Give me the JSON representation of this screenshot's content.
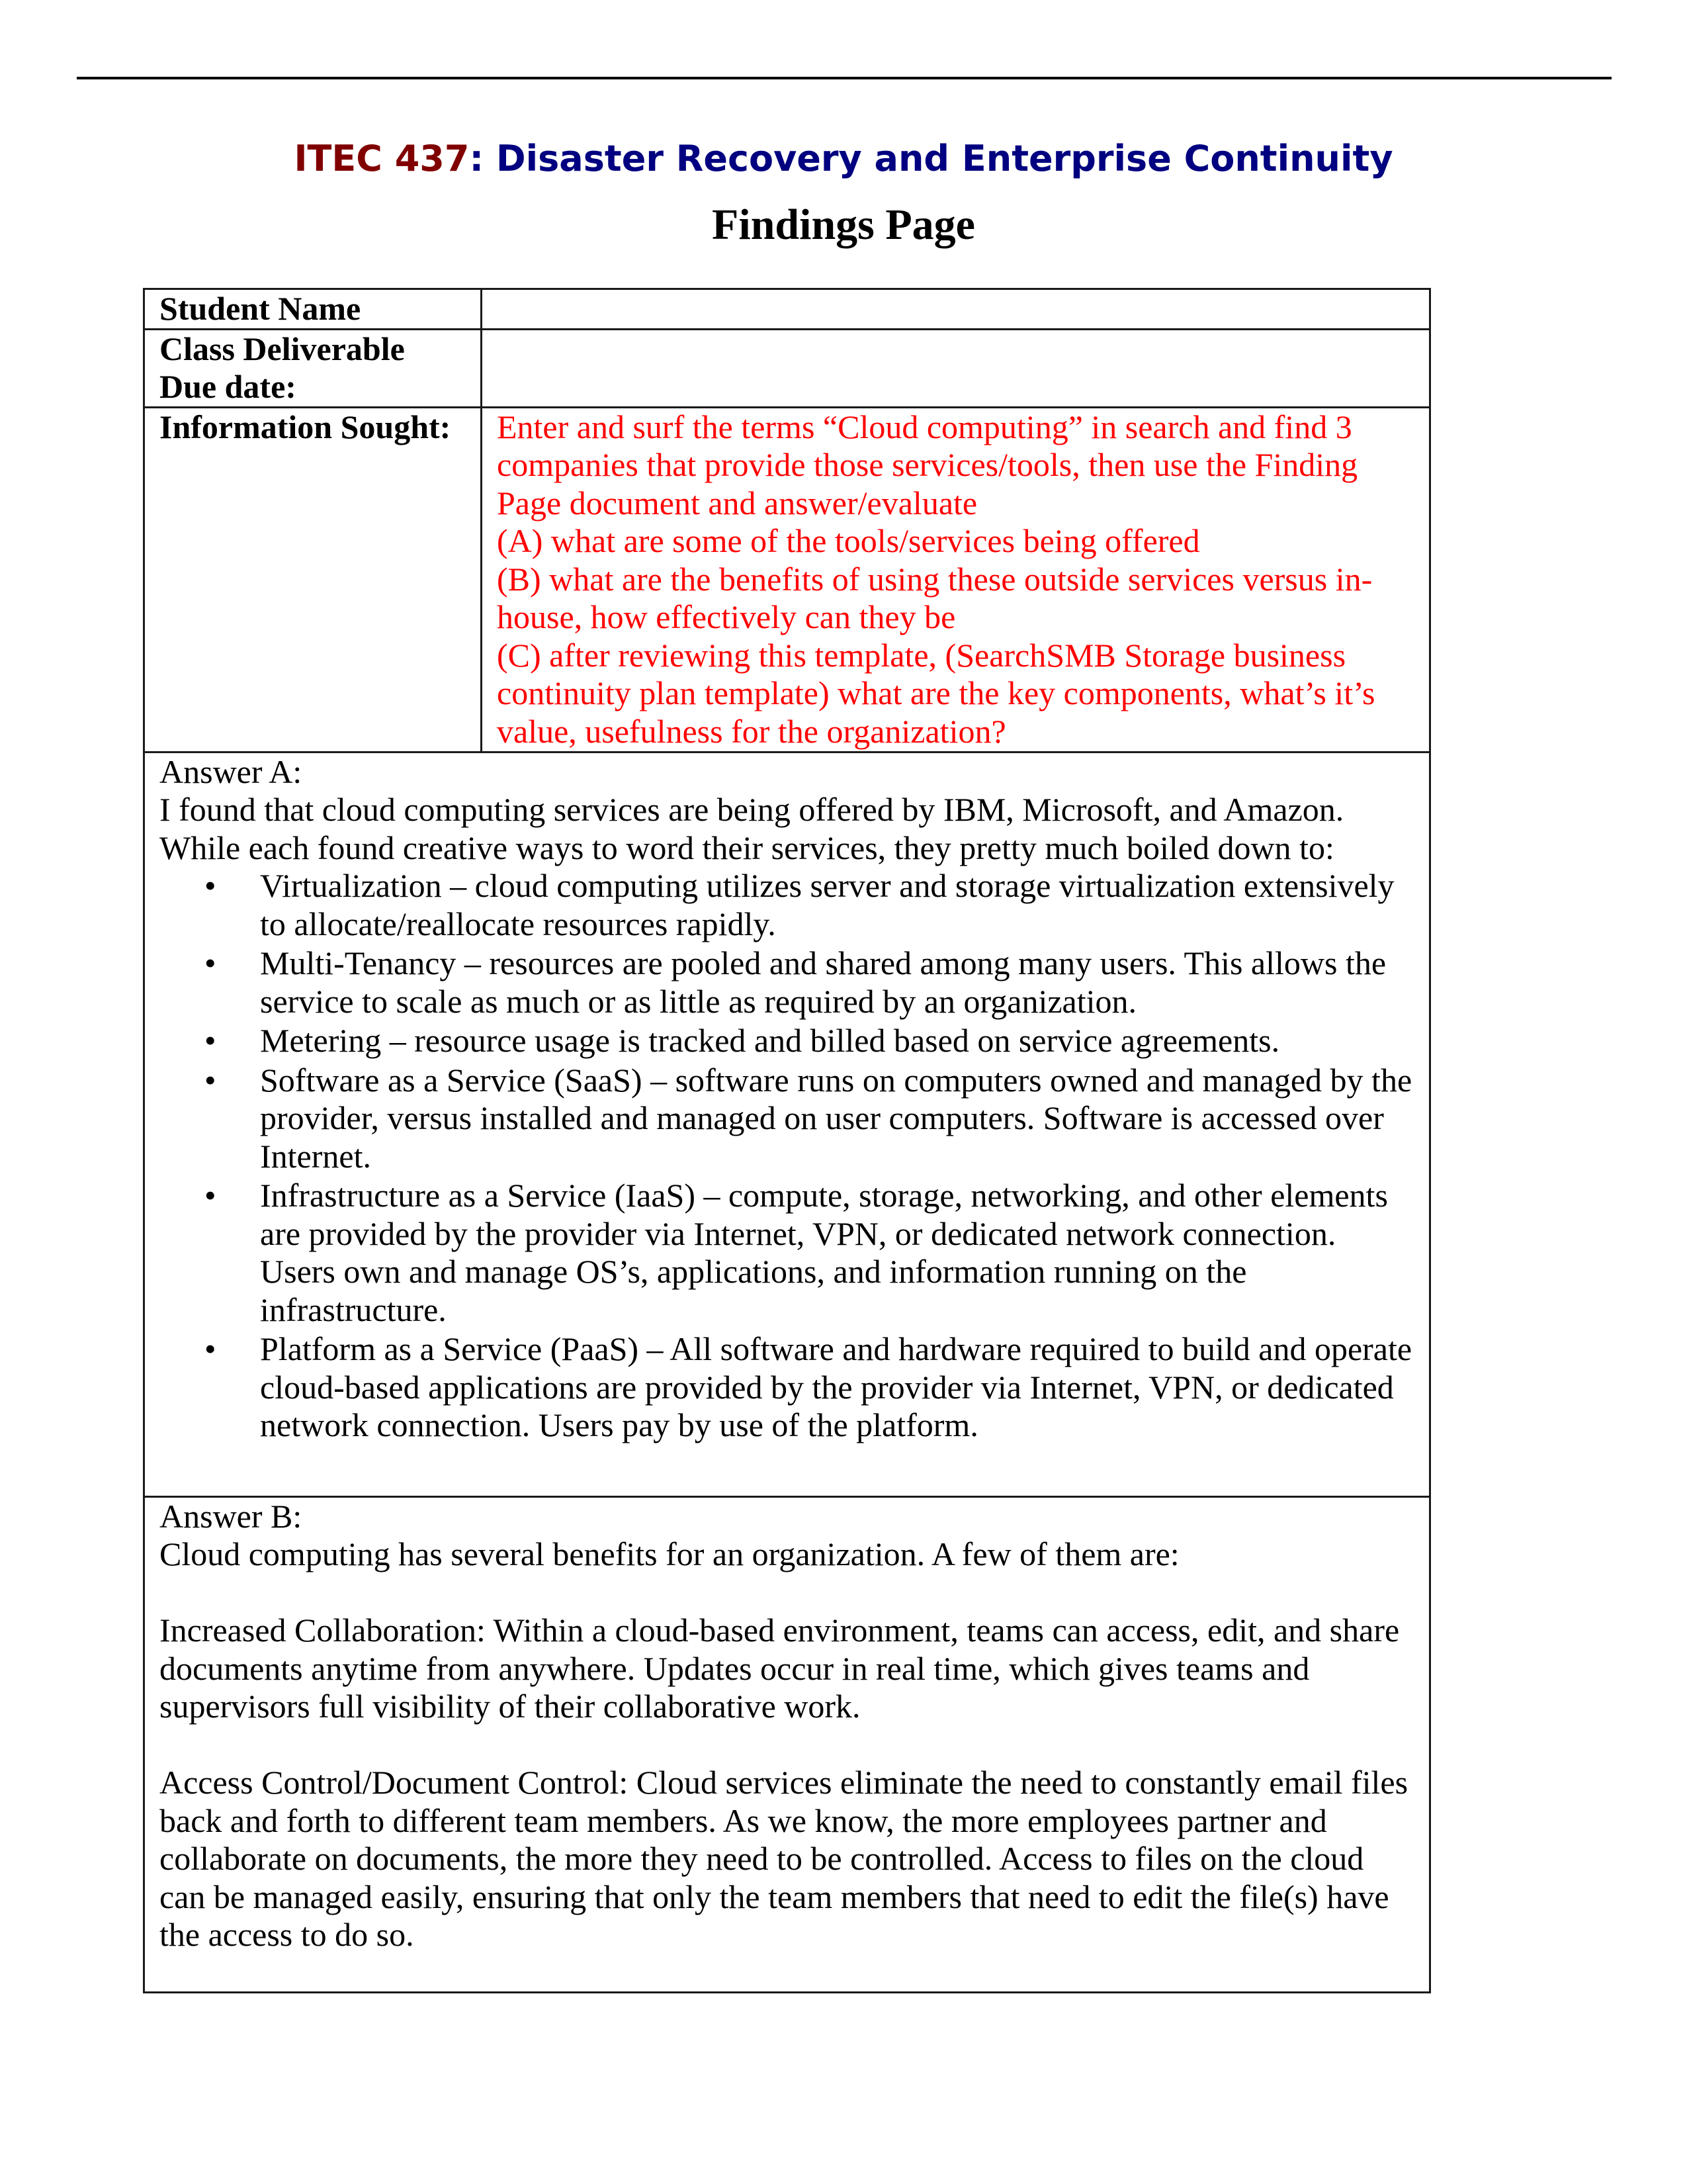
{
  "header": {
    "course_code": "ITEC 437",
    "course_title": ": Disaster Recovery and Enterprise Continuity",
    "page_title": "Findings Page",
    "colors": {
      "course_code": "#800000",
      "course_title": "#000080",
      "prompt_text": "#ff0000"
    }
  },
  "table": {
    "student_name_label": "Student Name",
    "student_name_value": "",
    "deliverable_label_line1": "Class Deliverable",
    "deliverable_label_line2": "Due date:",
    "deliverable_value": "",
    "info_sought_label": "Information Sought:",
    "info_sought_lines": [
      "Enter and surf the terms “Cloud computing” in search and find 3 companies that provide those services/tools, then use the Finding Page document and answer/evaluate",
      "(A) what are some of the tools/services being offered",
      "(B) what are the benefits of using these outside services versus in-house, how effectively can they be",
      "(C) after reviewing this template, (SearchSMB Storage business continuity plan template) what are the key components, what’s it’s value, usefulness for the organization?"
    ]
  },
  "answer_a": {
    "heading": "Answer A:",
    "intro": "I found that cloud computing services are being offered by IBM, Microsoft, and Amazon. While each found creative ways to word their services, they pretty much boiled down to:",
    "bullet_glyph": "•",
    "bullets": [
      "Virtualization – cloud computing utilizes server and storage virtualization extensively to allocate/reallocate resources rapidly.",
      "Multi-Tenancy – resources are pooled and shared among many users. This allows the service to scale as much or as little as required by an organization.",
      "Metering – resource usage is tracked and billed based on service agreements.",
      "Software as a Service (SaaS) – software runs on computers owned and managed by the provider, versus installed and managed on user computers. Software is accessed over Internet.",
      "Infrastructure as a Service (IaaS) – compute, storage, networking, and other elements are provided by the provider via Internet, VPN, or dedicated network connection. Users own and manage OS’s, applications, and information running on the infrastructure.",
      "Platform as a Service (PaaS) – All software and hardware required to build and operate cloud-based applications are provided by the provider via Internet, VPN, or dedicated network connection. Users pay by use of the platform."
    ]
  },
  "answer_b": {
    "heading": "Answer B:",
    "intro": "Cloud computing has several benefits for an organization. A few of them are:",
    "paragraphs": [
      "Increased Collaboration: Within a cloud-based environment, teams can access, edit, and share documents anytime from anywhere. Updates occur in real time, which gives teams and supervisors full visibility of their collaborative work.",
      "Access Control/Document Control: Cloud services eliminate the need to constantly email files back and forth to different team members. As we know, the more employees partner and collaborate on documents, the more they need to be controlled. Access to files on the cloud can be managed easily, ensuring that only the team members that need to edit the file(s) have the access to do so."
    ]
  }
}
